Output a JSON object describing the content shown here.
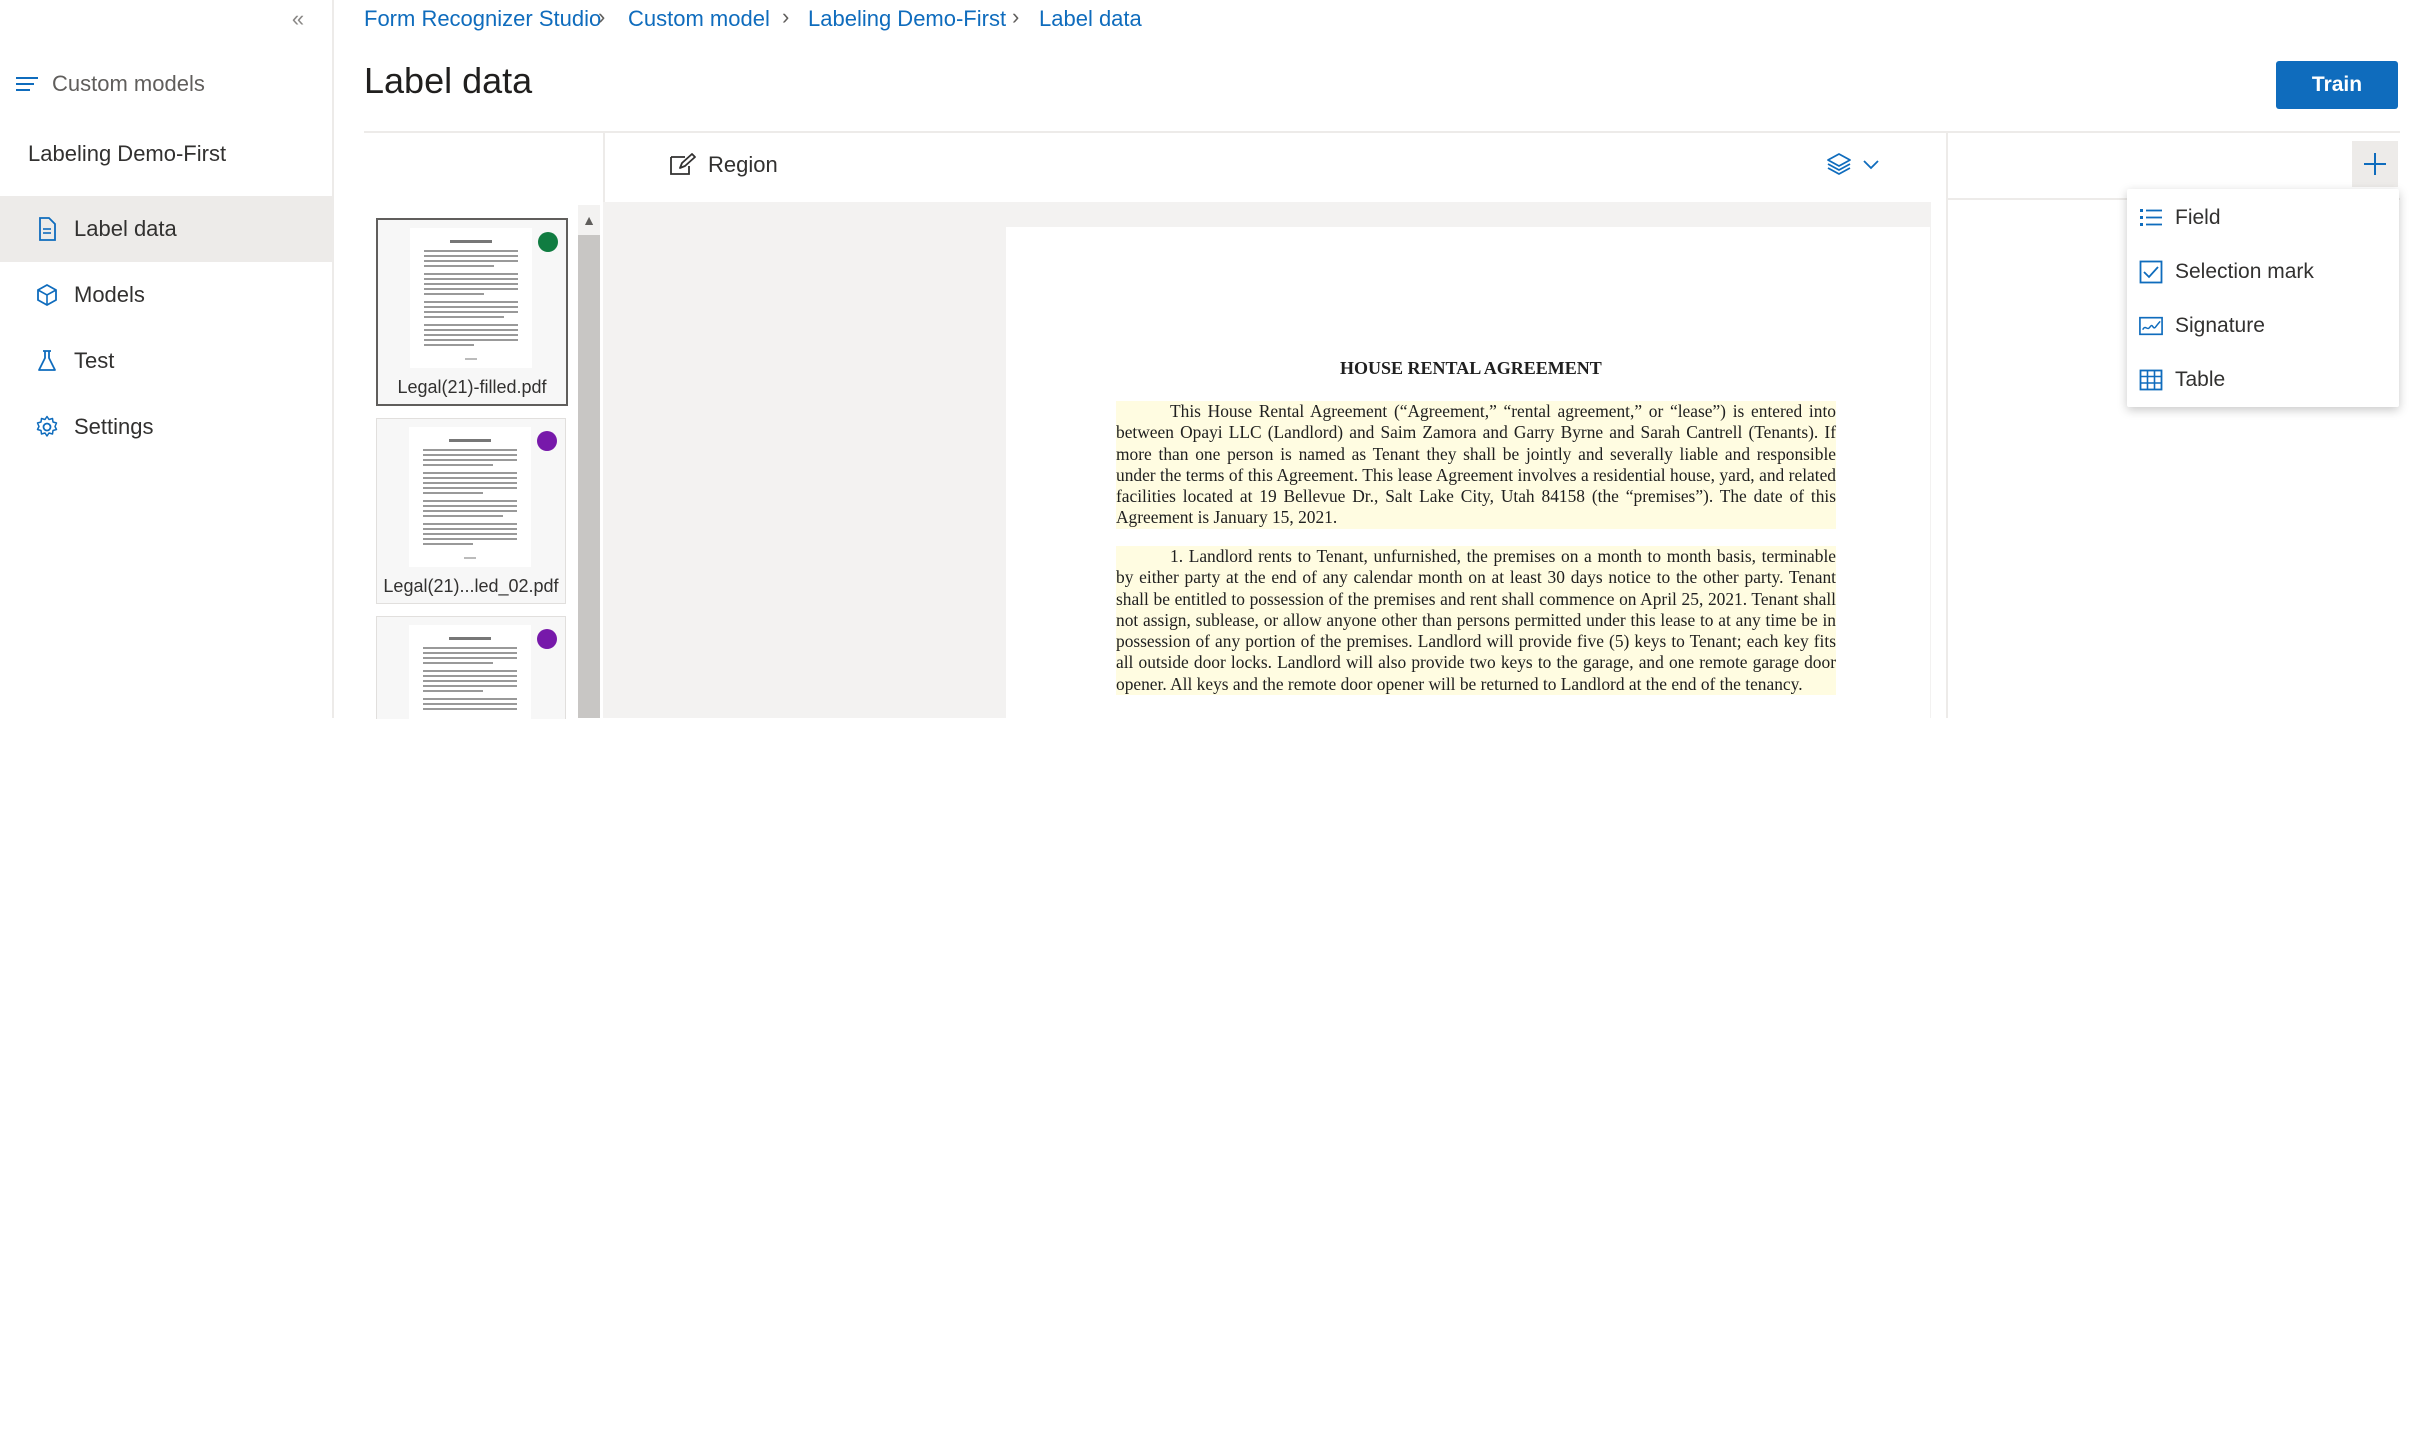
{
  "sidebar": {
    "collapse_glyph": "«",
    "header_label": "Custom models",
    "project_name": "Labeling Demo-First",
    "items": [
      {
        "label": "Label data",
        "icon": "document-icon"
      },
      {
        "label": "Models",
        "icon": "cube-icon"
      },
      {
        "label": "Test",
        "icon": "flask-icon"
      },
      {
        "label": "Settings",
        "icon": "gear-icon"
      }
    ]
  },
  "breadcrumb": [
    "Form Recognizer Studio",
    "Custom model",
    "Labeling Demo-First",
    "Label data"
  ],
  "page_title": "Label data",
  "train_label": "Train",
  "toolbar": {
    "region_label": "Region"
  },
  "files": [
    {
      "name": "Legal(21)-filled.pdf",
      "dot_color": "#107c41"
    },
    {
      "name": "Legal(21)...led_02.pdf",
      "dot_color": "#7719aa"
    },
    {
      "name": "",
      "dot_color": "#7719aa"
    }
  ],
  "document": {
    "title": "HOUSE RENTAL AGREEMENT",
    "paragraph1": "This House Rental Agreement (“Agreement,” “rental agreement,” or “lease”) is entered into between Opayi LLC (Landlord) and Saim Zamora and Garry Byrne and Sarah Cantrell (Tenants). If more than one person is named as Tenant they shall be jointly and severally liable and responsible under the terms of this Agreement. This lease Agreement involves a residential house, yard, and related facilities located at 19 Bellevue Dr., Salt Lake City, Utah 84158 (the “premises”). The date of this Agreement is January 15, 2021.",
    "paragraph2": "1. Landlord rents to Tenant, unfurnished, the premises on a month to month basis, terminable by either party at the end of any calendar month on at least 30 days notice to the other party. Tenant shall be entitled to possession of the premises and rent shall commence on April 25, 2021. Tenant shall not assign, sublease, or allow anyone other than persons permitted under this lease to at any time be in possession of any portion of the premises. Landlord will provide five (5) keys to Tenant; each key fits all outside door locks. Landlord will also provide two keys to the garage, and one remote garage door opener. All keys and the remote door opener will be returned to Landlord at the end of the tenancy."
  },
  "add_menu": {
    "items": [
      {
        "label": "Field",
        "icon": "list-icon"
      },
      {
        "label": "Selection mark",
        "icon": "checkbox-icon"
      },
      {
        "label": "Signature",
        "icon": "signature-icon"
      },
      {
        "label": "Table",
        "icon": "table-icon"
      }
    ]
  }
}
